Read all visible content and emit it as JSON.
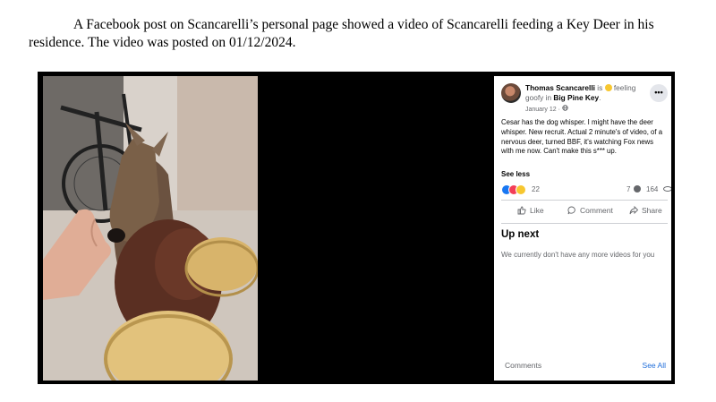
{
  "caption": "A Facebook post on Scancarelli’s personal page showed a video of Scancarelli feeding a Key Deer in his residence.  The video was posted on 01/12/2024.",
  "post": {
    "author": "Thomas Scancarelli",
    "activity_prefix": "is",
    "feeling": "feeling goofy in",
    "location": "Big Pine Key",
    "location_suffix": ".",
    "date": "January 12 · ",
    "more": "•••",
    "text": "Cesar has the dog whisper. I might have the deer whisper. New recruit. Actual 2 minute's of video, of a nervous deer, turned BBF, it's watching Fox news with me now. Can't make this s*** up.",
    "see_less": "See less",
    "reaction_count": "22",
    "comment_count": "7",
    "view_count": "164"
  },
  "actions": {
    "like": "Like",
    "comment": "Comment",
    "share": "Share"
  },
  "up_next": {
    "title": "Up next",
    "empty_message": "We currently don't have any more videos for you"
  },
  "footer": {
    "comments": "Comments",
    "see_all": "See All"
  },
  "colors": {
    "link": "#216fdb",
    "like_reaction": "#1877f2",
    "love_reaction": "#f33e58",
    "care_reaction": "#f7c730"
  },
  "icons": [
    "more-icon",
    "feeling-emoji-icon",
    "globe-icon",
    "like-icon",
    "comment-icon",
    "share-icon",
    "eye-icon"
  ]
}
